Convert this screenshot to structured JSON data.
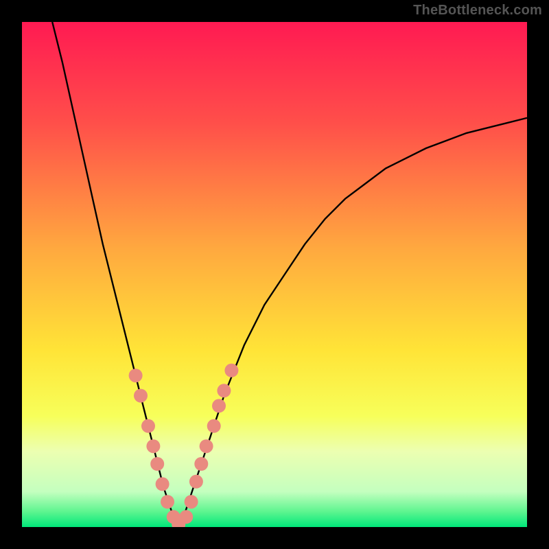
{
  "watermark": "TheBottleneck.com",
  "chart_data": {
    "type": "line",
    "title": "",
    "xlabel": "",
    "ylabel": "",
    "xlim": [
      0,
      100
    ],
    "ylim": [
      0,
      100
    ],
    "grid": false,
    "legend": false,
    "background_gradient": {
      "stops": [
        {
          "pos": 0.0,
          "color": "#ff1a52"
        },
        {
          "pos": 0.2,
          "color": "#ff4f4a"
        },
        {
          "pos": 0.45,
          "color": "#ffa93f"
        },
        {
          "pos": 0.65,
          "color": "#ffe437"
        },
        {
          "pos": 0.78,
          "color": "#f7ff5a"
        },
        {
          "pos": 0.85,
          "color": "#ecffb1"
        },
        {
          "pos": 0.93,
          "color": "#c4ffbf"
        },
        {
          "pos": 0.97,
          "color": "#5cf58f"
        },
        {
          "pos": 1.0,
          "color": "#00e77a"
        }
      ]
    },
    "series": [
      {
        "name": "bottleneck-curve",
        "color": "#000000",
        "x": [
          6,
          8,
          10,
          12,
          14,
          16,
          18,
          20,
          22,
          24,
          25,
          26,
          27,
          28,
          29,
          30,
          31,
          32,
          33,
          34,
          36,
          38,
          40,
          44,
          48,
          52,
          56,
          60,
          64,
          68,
          72,
          76,
          80,
          84,
          88,
          92,
          96,
          100
        ],
        "y": [
          100,
          92,
          83,
          74,
          65,
          56,
          48,
          40,
          32,
          24,
          20,
          16,
          12,
          8,
          5,
          2,
          0,
          2,
          5,
          8,
          14,
          20,
          26,
          36,
          44,
          50,
          56,
          61,
          65,
          68,
          71,
          73,
          75,
          76.5,
          78,
          79,
          80,
          81
        ]
      }
    ],
    "beads": {
      "name": "data-beads",
      "color": "#e98a80",
      "radius_px": 10,
      "points": [
        {
          "x": 22.5,
          "y": 30
        },
        {
          "x": 23.5,
          "y": 26
        },
        {
          "x": 25.0,
          "y": 20
        },
        {
          "x": 26.0,
          "y": 16
        },
        {
          "x": 26.8,
          "y": 12.5
        },
        {
          "x": 27.8,
          "y": 8.5
        },
        {
          "x": 28.8,
          "y": 5
        },
        {
          "x": 30.0,
          "y": 2
        },
        {
          "x": 31.0,
          "y": 0.5
        },
        {
          "x": 32.5,
          "y": 2
        },
        {
          "x": 33.5,
          "y": 5
        },
        {
          "x": 34.5,
          "y": 9
        },
        {
          "x": 35.5,
          "y": 12.5
        },
        {
          "x": 36.5,
          "y": 16
        },
        {
          "x": 38.0,
          "y": 20
        },
        {
          "x": 39.0,
          "y": 24
        },
        {
          "x": 40.0,
          "y": 27
        },
        {
          "x": 41.5,
          "y": 31
        }
      ]
    }
  }
}
